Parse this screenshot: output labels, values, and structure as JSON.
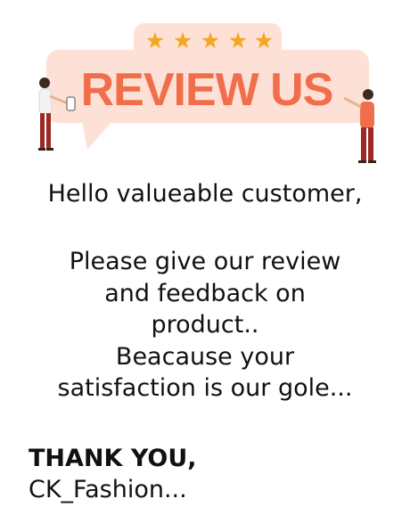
{
  "banner": {
    "title": "REVIEW US",
    "stars": 5,
    "colors": {
      "bubble": "#fde1d6",
      "star_panel": "#fde1d6",
      "title": "#f16e4c",
      "star": "#f5a623"
    }
  },
  "greeting": "Hello valueable customer,",
  "message": {
    "lines": [
      "Please give our review",
      "and feedback on",
      "product..",
      "Beacause your",
      "satisfaction is our gole..."
    ]
  },
  "signoff": {
    "thanks": "THANK YOU,",
    "brand": "CK_Fashion..."
  }
}
